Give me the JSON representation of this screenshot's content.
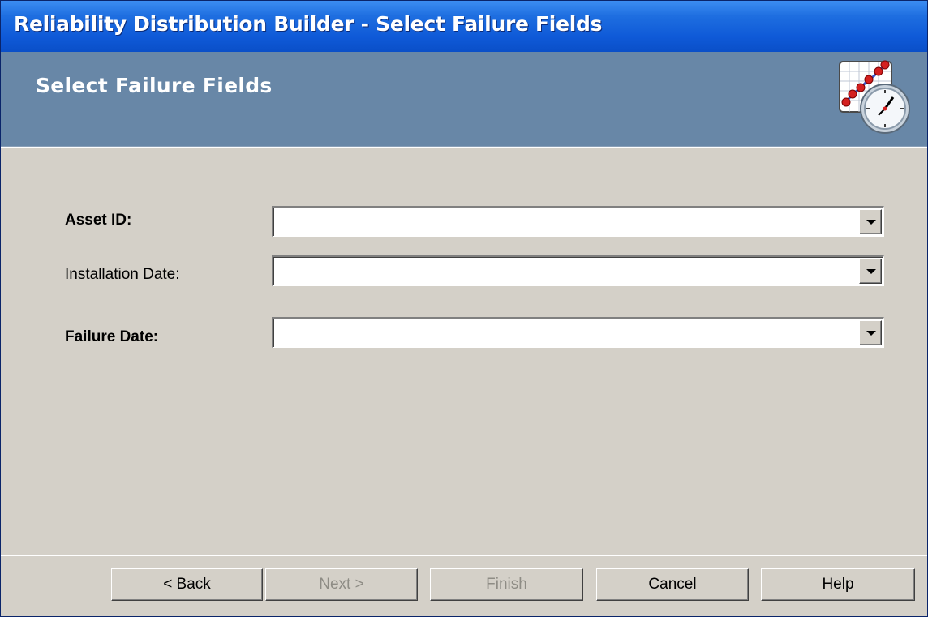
{
  "window": {
    "title": "Reliability Distribution Builder - Select Failure Fields"
  },
  "header": {
    "title": "Select Failure Fields",
    "icon": "distribution-chart-clock-icon"
  },
  "form": {
    "fields": [
      {
        "label": "Asset ID:",
        "bold": true,
        "value": ""
      },
      {
        "label": "Installation Date:",
        "bold": false,
        "value": ""
      },
      {
        "label": "Failure Date:",
        "bold": true,
        "value": ""
      }
    ]
  },
  "buttons": {
    "back": {
      "label": "< Back",
      "enabled": true
    },
    "next": {
      "label": "Next >",
      "enabled": false
    },
    "finish": {
      "label": "Finish",
      "enabled": false
    },
    "cancel": {
      "label": "Cancel",
      "enabled": true
    },
    "help": {
      "label": "Help",
      "enabled": true
    }
  },
  "colors": {
    "titlebar": "#0f5ad8",
    "header_band": "#6887a7",
    "dialog_face": "#d4d0c8",
    "disabled_text": "#8e8c85"
  }
}
